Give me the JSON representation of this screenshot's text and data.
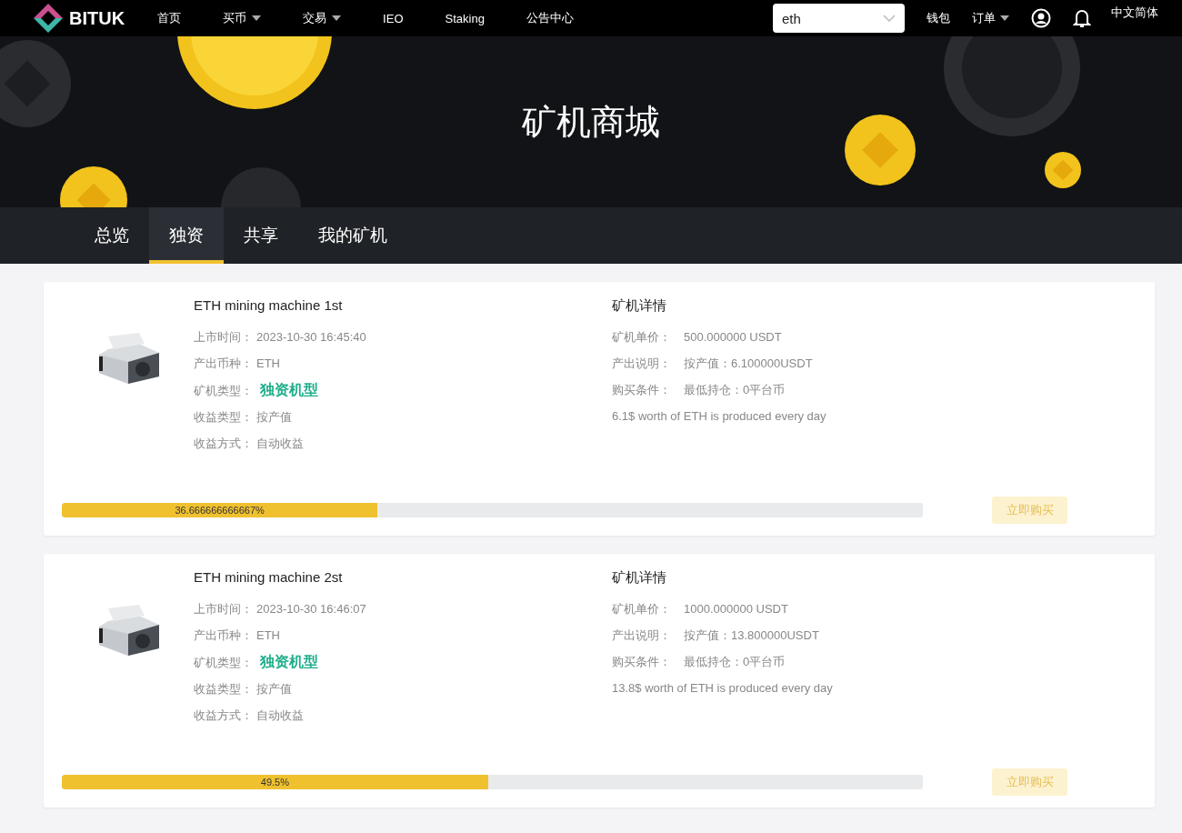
{
  "nav": {
    "logo": "BITUK",
    "items": [
      {
        "label": "首页",
        "dropdown": false
      },
      {
        "label": "买币",
        "dropdown": true
      },
      {
        "label": "交易",
        "dropdown": true
      },
      {
        "label": "IEO",
        "dropdown": false
      },
      {
        "label": "Staking",
        "dropdown": false
      },
      {
        "label": "公告中心",
        "dropdown": false
      }
    ],
    "search": {
      "value": "eth"
    },
    "right_items": [
      {
        "label": "钱包",
        "dropdown": false
      },
      {
        "label": "订单",
        "dropdown": true
      }
    ],
    "language": "中文简体"
  },
  "hero": {
    "title": "矿机商城"
  },
  "tabs": [
    {
      "label": "总览",
      "selected": false
    },
    {
      "label": "独资",
      "selected": true
    },
    {
      "label": "共享",
      "selected": false
    },
    {
      "label": "我的矿机",
      "selected": false
    }
  ],
  "products": [
    {
      "name": "ETH mining machine 1st",
      "info": [
        {
          "label": "上市时间：",
          "value": "2023-10-30 16:45:40",
          "kind": "plain"
        },
        {
          "label": "产出币种：",
          "value": "ETH",
          "kind": "plain"
        },
        {
          "label": "矿机类型：",
          "value": "独资机型",
          "kind": "highlight"
        },
        {
          "label": "收益类型：",
          "value": "按产值",
          "kind": "plain"
        },
        {
          "label": "收益方式：",
          "value": "自动收益",
          "kind": "plain"
        }
      ],
      "details_title": "矿机详情",
      "details": [
        {
          "label": "矿机单价：",
          "value": "500.000000 USDT"
        },
        {
          "label": "产出说明：",
          "value": "按产值：6.100000USDT"
        },
        {
          "label": "购买条件：",
          "value": "最低持仓：0平台币"
        }
      ],
      "note": "6.1$ worth of ETH is produced every day",
      "progress": {
        "level": 0.3667,
        "label": "36.666666666667%"
      },
      "button": "立即购买"
    },
    {
      "name": "ETH mining machine 2st",
      "info": [
        {
          "label": "上市时间：",
          "value": "2023-10-30 16:46:07",
          "kind": "plain"
        },
        {
          "label": "产出币种：",
          "value": "ETH",
          "kind": "plain"
        },
        {
          "label": "矿机类型：",
          "value": "独资机型",
          "kind": "highlight"
        },
        {
          "label": "收益类型：",
          "value": "按产值",
          "kind": "plain"
        },
        {
          "label": "收益方式：",
          "value": "自动收益",
          "kind": "plain"
        }
      ],
      "details_title": "矿机详情",
      "details": [
        {
          "label": "矿机单价：",
          "value": "1000.000000 USDT"
        },
        {
          "label": "产出说明：",
          "value": "按产值：13.800000USDT"
        },
        {
          "label": "购买条件：",
          "value": "最低持仓：0平台币"
        }
      ],
      "note": "13.8$ worth of ETH is produced every day",
      "progress": {
        "level": 0.495,
        "label": "49.5%"
      },
      "button": "立即购买"
    }
  ]
}
